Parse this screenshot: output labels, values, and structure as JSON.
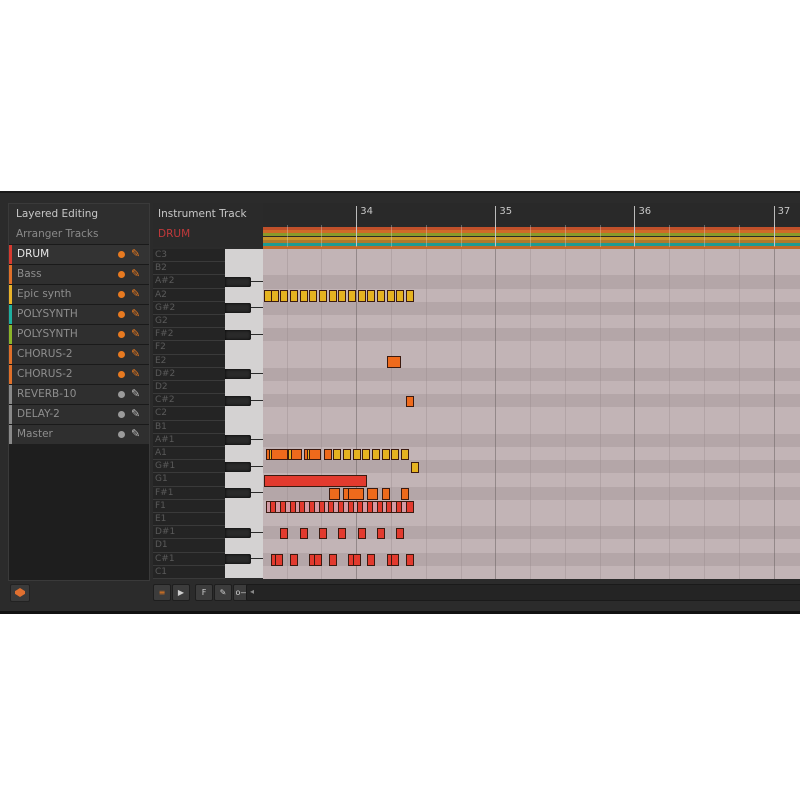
{
  "colors": {
    "accent": "#e87a20",
    "drum_red": "#e23a2e",
    "yellow_note": "#e5b320",
    "orange_note": "#ee6a1c",
    "pink_note": "#d49aa4"
  },
  "left_panel": {
    "heading": "Layered Editing",
    "subheading": "Arranger Tracks",
    "tracks": [
      {
        "label": "DRUM",
        "color": "#d63a2f",
        "selected": true,
        "active": true
      },
      {
        "label": "Bass",
        "color": "#e0702a",
        "selected": false,
        "active": true
      },
      {
        "label": "Epic synth",
        "color": "#e8b22a",
        "selected": false,
        "active": true
      },
      {
        "label": "POLYSYNTH",
        "color": "#1fb0a0",
        "selected": false,
        "active": true
      },
      {
        "label": "POLYSYNTH",
        "color": "#8bb52a",
        "selected": false,
        "active": true
      },
      {
        "label": "CHORUS-2",
        "color": "#e0702a",
        "selected": false,
        "active": true
      },
      {
        "label": "CHORUS-2",
        "color": "#e0702a",
        "selected": false,
        "active": true
      },
      {
        "label": "REVERB-10",
        "color": "#8a8a8a",
        "selected": false,
        "active": false
      },
      {
        "label": "DELAY-2",
        "color": "#8a8a8a",
        "selected": false,
        "active": false
      },
      {
        "label": "Master",
        "color": "#8a8a8a",
        "selected": false,
        "active": false
      }
    ],
    "bottom_button_icon": "layers-icon"
  },
  "header": {
    "title": "Instrument Track",
    "track_name": "DRUM"
  },
  "ruler": {
    "bars": [
      "34",
      "35",
      "36",
      "37"
    ],
    "lane_colors": [
      "#c0502a",
      "#d06a28",
      "#8a9a2a",
      "#c8962a",
      "#b07a2a",
      "#1e9a90",
      "#c06a2a"
    ]
  },
  "keyboard": {
    "notes": [
      "C3",
      "B2",
      "A#2",
      "A2",
      "G#2",
      "G2",
      "F#2",
      "F2",
      "E2",
      "D#2",
      "D2",
      "C#2",
      "C2",
      "B1",
      "A#1",
      "A1",
      "G#1",
      "G1",
      "F#1",
      "F1",
      "E1",
      "D#1",
      "D1",
      "C#1",
      "C1"
    ]
  },
  "notes": [
    {
      "pitch": "A2",
      "color": "yellow",
      "start": 0.0,
      "len": 0.06
    },
    {
      "pitch": "A2",
      "color": "yellow",
      "start": 0.17,
      "len": 0.13
    },
    {
      "pitch": "A2",
      "color": "yellow",
      "start": 0.42,
      "len": 0.13
    },
    {
      "pitch": "A2",
      "color": "yellow",
      "start": 0.67,
      "len": 0.13
    },
    {
      "pitch": "A2",
      "color": "yellow",
      "start": 0.92,
      "len": 0.13
    },
    {
      "pitch": "A2",
      "color": "yellow",
      "start": 1.17,
      "len": 0.13
    },
    {
      "pitch": "A2",
      "color": "yellow",
      "start": 1.42,
      "len": 0.13
    },
    {
      "pitch": "A2",
      "color": "yellow",
      "start": 1.67,
      "len": 0.13
    },
    {
      "pitch": "A2",
      "color": "yellow",
      "start": 1.92,
      "len": 0.13
    },
    {
      "pitch": "A2",
      "color": "yellow",
      "start": 2.17,
      "len": 0.13
    },
    {
      "pitch": "A2",
      "color": "yellow",
      "start": 2.42,
      "len": 0.13
    },
    {
      "pitch": "A2",
      "color": "yellow",
      "start": 2.67,
      "len": 0.13
    },
    {
      "pitch": "A2",
      "color": "yellow",
      "start": 2.92,
      "len": 0.13
    },
    {
      "pitch": "A2",
      "color": "yellow",
      "start": 3.17,
      "len": 0.13
    },
    {
      "pitch": "A2",
      "color": "yellow",
      "start": 3.42,
      "len": 0.13
    },
    {
      "pitch": "A2",
      "color": "yellow",
      "start": 3.67,
      "len": 0.13
    },
    {
      "pitch": "E2",
      "color": "orange",
      "start": 3.17,
      "len": 0.37
    },
    {
      "pitch": "C#2",
      "color": "orange",
      "start": 3.67,
      "len": 0.2
    },
    {
      "pitch": "A1",
      "color": "orange",
      "start": 0.05,
      "len": 0.07
    },
    {
      "pitch": "A1",
      "color": "yellow",
      "start": 0.12,
      "len": 0.05
    },
    {
      "pitch": "A1",
      "color": "orange",
      "start": 0.17,
      "len": 0.45
    },
    {
      "pitch": "A1",
      "color": "yellow",
      "start": 0.62,
      "len": 0.08
    },
    {
      "pitch": "A1",
      "color": "orange",
      "start": 0.7,
      "len": 0.27
    },
    {
      "pitch": "A1",
      "color": "orange",
      "start": 1.04,
      "len": 0.08
    },
    {
      "pitch": "A1",
      "color": "yellow",
      "start": 1.12,
      "len": 0.05
    },
    {
      "pitch": "A1",
      "color": "orange",
      "start": 1.17,
      "len": 0.3
    },
    {
      "pitch": "A1",
      "color": "orange",
      "start": 1.54,
      "len": 0.13
    },
    {
      "pitch": "A1",
      "color": "yellow",
      "start": 1.79,
      "len": 0.13
    },
    {
      "pitch": "A1",
      "color": "yellow",
      "start": 2.04,
      "len": 0.13
    },
    {
      "pitch": "A1",
      "color": "yellow",
      "start": 2.29,
      "len": 0.13
    },
    {
      "pitch": "A1",
      "color": "yellow",
      "start": 2.54,
      "len": 0.13
    },
    {
      "pitch": "A1",
      "color": "yellow",
      "start": 2.79,
      "len": 0.13
    },
    {
      "pitch": "A1",
      "color": "yellow",
      "start": 3.04,
      "len": 0.13
    },
    {
      "pitch": "A1",
      "color": "yellow",
      "start": 3.29,
      "len": 0.13
    },
    {
      "pitch": "A1",
      "color": "yellow",
      "start": 3.54,
      "len": 0.13
    },
    {
      "pitch": "G#1",
      "color": "yellow",
      "start": 3.79,
      "len": 0.13
    },
    {
      "pitch": "G1",
      "color": "red",
      "start": 0.0,
      "len": 2.67
    },
    {
      "pitch": "F#1",
      "color": "orange",
      "start": 1.67,
      "len": 0.29
    },
    {
      "pitch": "F#1",
      "color": "orange",
      "start": 2.04,
      "len": 0.08
    },
    {
      "pitch": "F#1",
      "color": "orange",
      "start": 2.17,
      "len": 0.42
    },
    {
      "pitch": "F#1",
      "color": "orange",
      "start": 2.67,
      "len": 0.29
    },
    {
      "pitch": "F#1",
      "color": "orange",
      "start": 3.04,
      "len": 0.08
    },
    {
      "pitch": "F#1",
      "color": "orange",
      "start": 3.54,
      "len": 0.13
    },
    {
      "pitch": "D#1",
      "color": "red",
      "start": 0.42,
      "len": 0.08
    },
    {
      "pitch": "D#1",
      "color": "red",
      "start": 0.92,
      "len": 0.08
    },
    {
      "pitch": "D#1",
      "color": "red",
      "start": 1.42,
      "len": 0.08
    },
    {
      "pitch": "D#1",
      "color": "red",
      "start": 1.92,
      "len": 0.08
    },
    {
      "pitch": "D#1",
      "color": "red",
      "start": 2.42,
      "len": 0.08
    },
    {
      "pitch": "D#1",
      "color": "red",
      "start": 2.92,
      "len": 0.08
    },
    {
      "pitch": "D#1",
      "color": "red",
      "start": 3.42,
      "len": 0.08
    },
    {
      "pitch": "C#1",
      "color": "red",
      "start": 0.17,
      "len": 0.08
    },
    {
      "pitch": "C#1",
      "color": "red",
      "start": 0.29,
      "len": 0.08
    },
    {
      "pitch": "C#1",
      "color": "red",
      "start": 0.67,
      "len": 0.08
    },
    {
      "pitch": "C#1",
      "color": "red",
      "start": 1.17,
      "len": 0.08
    },
    {
      "pitch": "C#1",
      "color": "red",
      "start": 1.29,
      "len": 0.08
    },
    {
      "pitch": "C#1",
      "color": "red",
      "start": 1.67,
      "len": 0.08
    },
    {
      "pitch": "C#1",
      "color": "red",
      "start": 2.17,
      "len": 0.08
    },
    {
      "pitch": "C#1",
      "color": "red",
      "start": 2.29,
      "len": 0.08
    },
    {
      "pitch": "C#1",
      "color": "red",
      "start": 2.67,
      "len": 0.08
    },
    {
      "pitch": "C#1",
      "color": "red",
      "start": 3.17,
      "len": 0.08
    },
    {
      "pitch": "C#1",
      "color": "red",
      "start": 3.29,
      "len": 0.08
    },
    {
      "pitch": "C#1",
      "color": "red",
      "start": 3.67,
      "len": 0.08
    }
  ],
  "hihat_row": {
    "pitch": "F1",
    "count": 30,
    "step": 0.125,
    "start": 0.04,
    "len": 0.07
  },
  "view": {
    "first_bar": 33.33,
    "bar_count": 3.86
  },
  "toolbar": {
    "buttons": [
      {
        "name": "layer-toggle-button",
        "label": "≡",
        "icon": "layers-toggle-icon"
      },
      {
        "name": "audio-event-button",
        "label": "▶",
        "icon": "waveform-icon"
      },
      {
        "name": "fold-button",
        "label": "F",
        "icon": "fold-icon"
      },
      {
        "name": "tool-button",
        "label": "✎",
        "icon": "pointer-tool-icon"
      },
      {
        "name": "key-button",
        "label": "o—",
        "icon": "key-icon"
      }
    ],
    "scroll_arrow": "◂"
  }
}
